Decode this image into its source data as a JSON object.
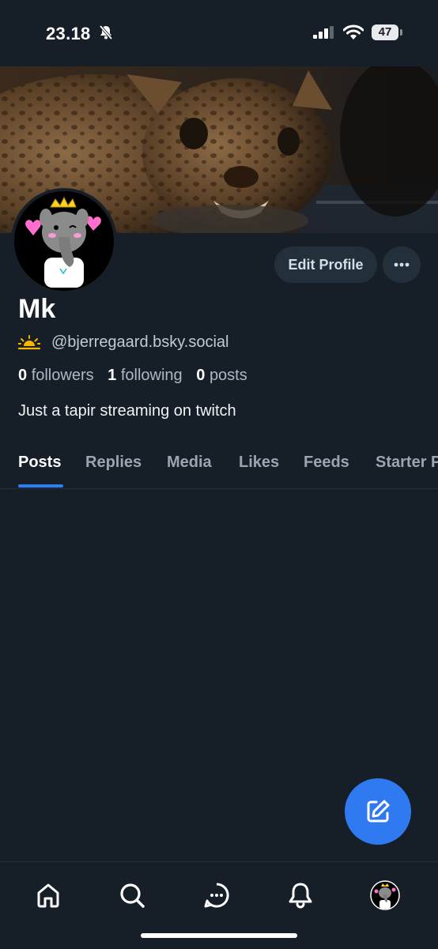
{
  "status_bar": {
    "time": "23.18",
    "battery": "47"
  },
  "profile": {
    "display_name": "Mk",
    "handle": "@bjerregaard.bsky.social",
    "followers_count": "0",
    "followers_label": "followers",
    "following_count": "1",
    "following_label": "following",
    "posts_count": "0",
    "posts_label": "posts",
    "bio": "Just a tapir streaming on twitch"
  },
  "actions": {
    "edit_label": "Edit Profile",
    "more_label": "···"
  },
  "tabs": [
    {
      "label": "Posts",
      "active": true
    },
    {
      "label": "Replies"
    },
    {
      "label": "Media"
    },
    {
      "label": "Likes"
    },
    {
      "label": "Feeds"
    },
    {
      "label": "Starter Packs"
    }
  ],
  "colors": {
    "background": "#161e27",
    "accent": "#2f79f1",
    "pill": "#232f3b"
  },
  "bottom_nav": [
    "home-icon",
    "search-icon",
    "chat-icon",
    "bell-icon",
    "profile-avatar"
  ]
}
